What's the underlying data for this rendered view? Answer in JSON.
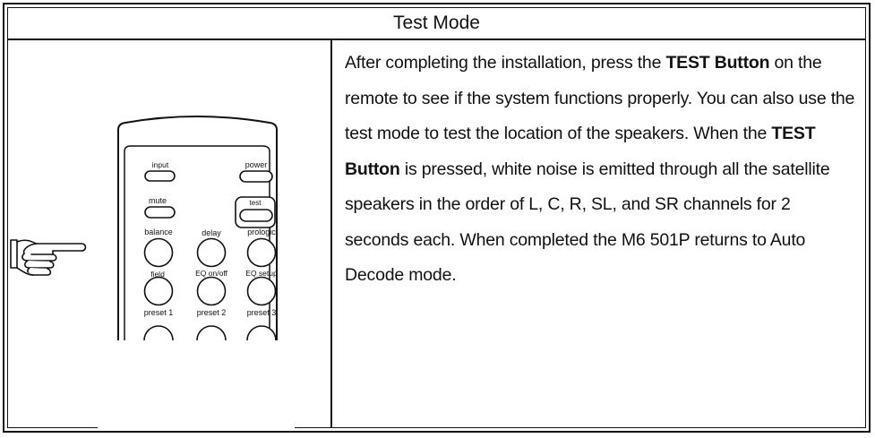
{
  "title": "Test Mode",
  "description": {
    "part1": "After completing the installation, press the ",
    "bold1": "TEST Button",
    "part2": " on the remote to see if the system functions properly. You can also use the test mode to test the location of the speakers. When the ",
    "bold2": "TEST Button",
    "part3": " is pressed, white noise is emitted through all the satellite speakers in the order of L, C, R, SL, and SR channels for 2 seconds each. When completed the M6 501P returns to Auto Decode mode."
  },
  "remote": {
    "labels": {
      "input": "input",
      "power": "power",
      "mute": "mute",
      "test": "test",
      "balance": "balance",
      "delay": "delay",
      "prologic": "prologic",
      "field": "field",
      "eq_onoff": "EQ on/off",
      "eq_setup": "EQ setup",
      "preset1": "preset 1",
      "preset2": "preset 2",
      "preset3": "preset 3"
    }
  },
  "icons": {
    "pointer": "pointing-hand-icon"
  }
}
